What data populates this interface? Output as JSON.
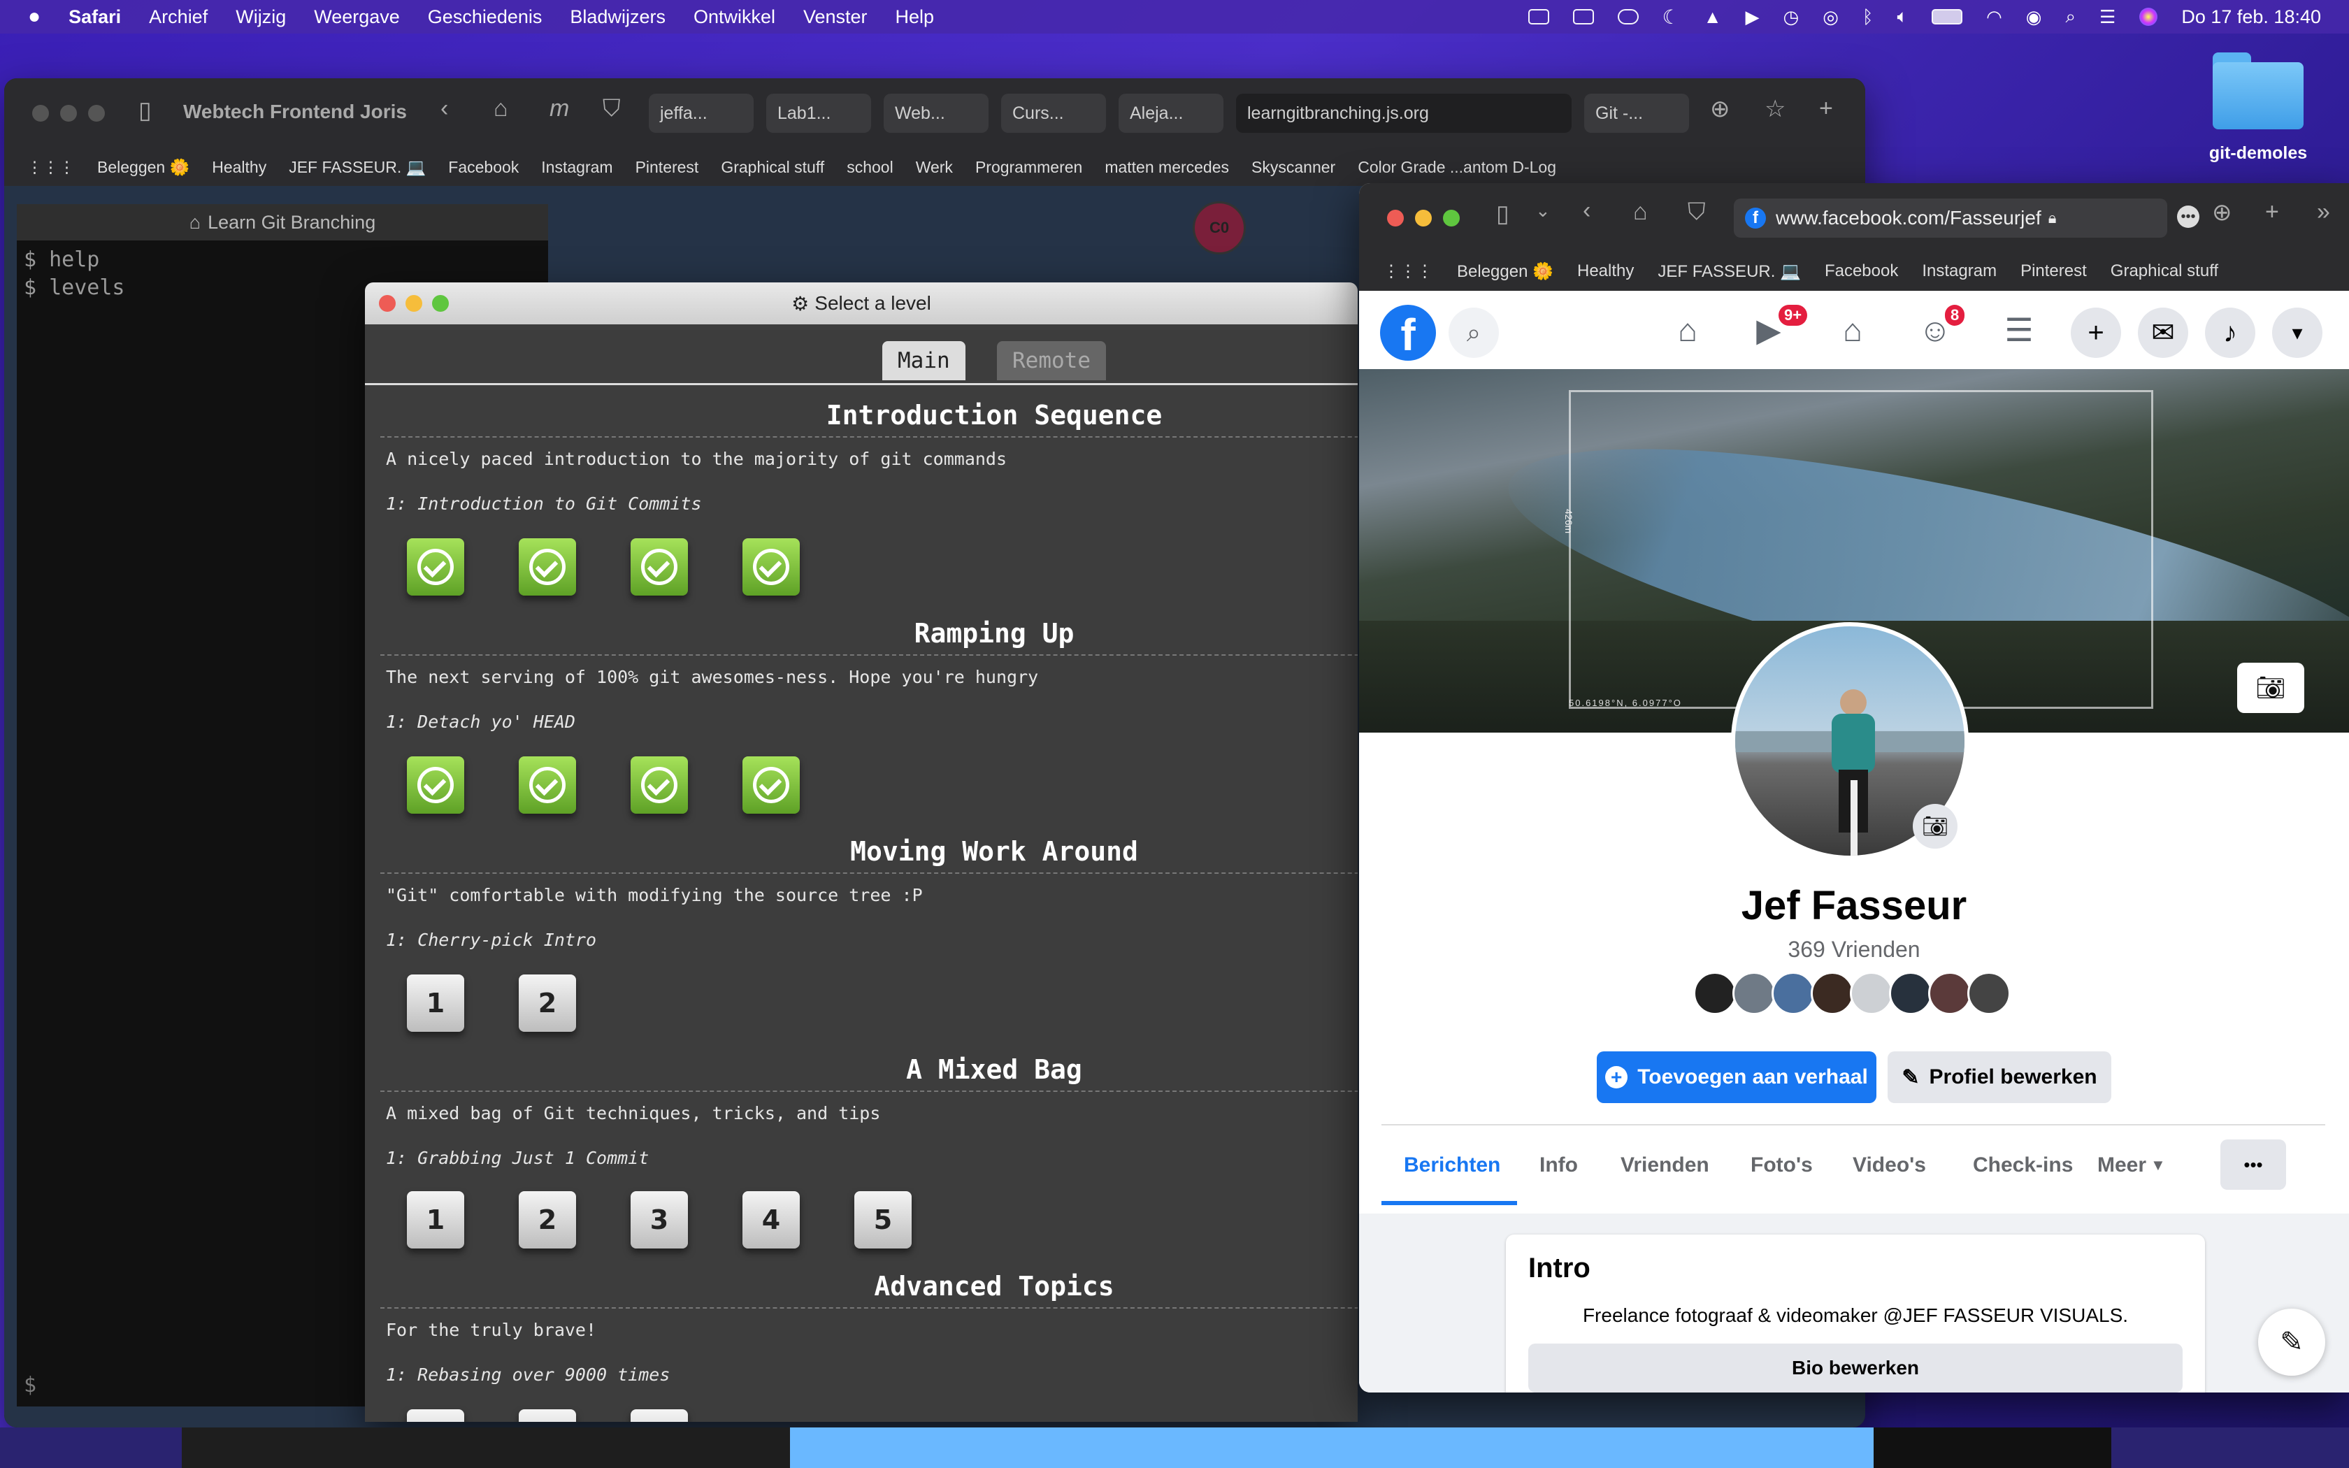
{
  "menubar": {
    "app": "Safari",
    "items": [
      "Archief",
      "Wijzig",
      "Weergave",
      "Geschiedenis",
      "Bladwijzers",
      "Ontwikkel",
      "Venster",
      "Help"
    ],
    "clock": "Do 17 feb.  18:40"
  },
  "desktop": {
    "folder_label": "git-demoles"
  },
  "back_window": {
    "title": "Webtech Frontend Joris",
    "tabs": [
      "jeffa...",
      "Lab1...",
      "Web...",
      "Curs...",
      "Aleja...",
      "learngitbranching.js.org",
      "Git -..."
    ],
    "bookmarks": [
      "Beleggen 🌼",
      "Healthy",
      "JEF FASSEUR. 💻",
      "Facebook",
      "Instagram",
      "Pinterest",
      "Graphical stuff",
      "school",
      "Werk",
      "Programmeren",
      "matten mercedes",
      "Skyscanner",
      "Color Grade ...antom D-Log"
    ],
    "terminal_title": "Learn Git Branching",
    "terminal_lines": [
      "$ help",
      "$ levels"
    ],
    "terminal_prompt": "$",
    "node_label": "C0"
  },
  "level_modal": {
    "title": "Select a level",
    "tabs": {
      "main": "Main",
      "remote": "Remote"
    },
    "sections": [
      {
        "title": "Introduction Sequence",
        "desc": "A nicely paced introduction to the majority of git commands",
        "level": "1: Introduction to Git Commits"
      },
      {
        "title": "Ramping Up",
        "desc": "The next serving of 100% git awesomes-ness. Hope you're hungry",
        "level": "1: Detach yo' HEAD"
      },
      {
        "title": "Moving Work Around",
        "desc": "\"Git\" comfortable with modifying the source tree :P",
        "level": "1: Cherry-pick Intro"
      },
      {
        "title": "A Mixed Bag",
        "desc": "A mixed bag of Git techniques, tricks, and tips",
        "level": "1: Grabbing Just 1 Commit"
      },
      {
        "title": "Advanced Topics",
        "desc": "For the truly brave!",
        "level": "1: Rebasing over 9000 times"
      }
    ],
    "level_numbers": {
      "cherry": [
        "1",
        "2"
      ],
      "mixed": [
        "1",
        "2",
        "3",
        "4",
        "5"
      ]
    }
  },
  "fb_window": {
    "url": "www.facebook.com/Fasseurjef",
    "bookmarks": [
      "Beleggen 🌼",
      "Healthy",
      "JEF FASSEUR. 💻",
      "Facebook",
      "Instagram",
      "Pinterest",
      "Graphical stuff"
    ],
    "badges": {
      "watch": "9+",
      "groups": "8"
    },
    "cover_coords": "50.6198°N, 6.0977°O",
    "cover_vertical": "426m",
    "name": "Jef Fasseur",
    "friends": "369 Vrienden",
    "btn_story": "Toevoegen aan verhaal",
    "btn_edit": "Profiel bewerken",
    "tabs": [
      "Berichten",
      "Info",
      "Vrienden",
      "Foto's",
      "Video's",
      "Check-ins",
      "Meer"
    ],
    "intro_title": "Intro",
    "intro_text": "Freelance fotograaf & videomaker @JEF FASSEUR VISUALS.",
    "bio_btn": "Bio bewerken",
    "accent": "#1877f2"
  }
}
